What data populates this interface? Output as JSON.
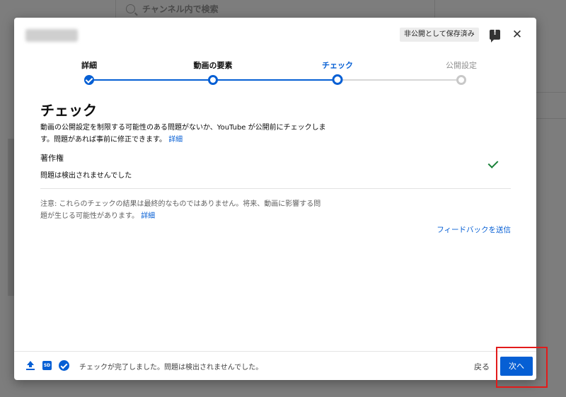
{
  "background": {
    "search_placeholder": "チャンネル内で検索"
  },
  "dialog": {
    "save_status": "非公開として保存済み",
    "steps": [
      {
        "label": "詳細",
        "state": "done"
      },
      {
        "label": "動画の要素",
        "state": "done"
      },
      {
        "label": "チェック",
        "state": "current"
      },
      {
        "label": "公開設定",
        "state": "future"
      }
    ],
    "heading": "チェック",
    "description": "動画の公開設定を制限する可能性のある問題がないか、YouTube が公開前にチェックします。問題があれば事前に修正できます。",
    "details_link": "詳細",
    "copyright": {
      "title": "著作権",
      "status": "問題は検出されませんでした"
    },
    "note": "注意: これらのチェックの結果は最終的なものではありません。将来、動画に影響する問題が生じる可能性があります。",
    "note_link": "詳細",
    "send_feedback": "フィードバックを送信",
    "footer": {
      "hd_badge": "SD",
      "status": "チェックが完了しました。問題は検出されませんでした。",
      "back": "戻る",
      "next": "次へ"
    },
    "colors": {
      "accent": "#065fd4",
      "success": "#188038",
      "highlight": "#e21b1b"
    }
  }
}
